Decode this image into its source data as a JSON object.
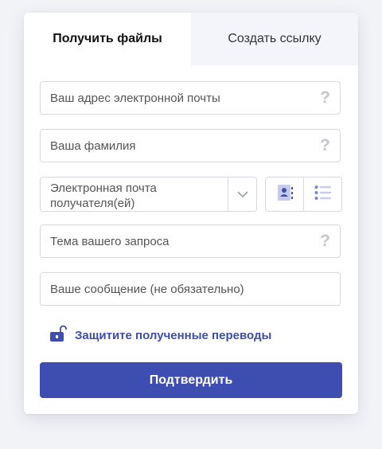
{
  "tabs": [
    {
      "label": "Получить файлы",
      "active": true
    },
    {
      "label": "Создать ссылку",
      "active": false
    }
  ],
  "form": {
    "email_placeholder": "Ваш адрес электронной почты",
    "lastname_placeholder": "Ваша фамилия",
    "recipient_placeholder": "Электронная почта получателя(ей)",
    "subject_placeholder": "Тема вашего запроса",
    "message_placeholder": "Ваше сообщение (не обязательно)",
    "help_symbol": "?"
  },
  "protect_label": "Защитите полученные переводы",
  "submit_label": "Подтвердить",
  "icons": {
    "help": "question-mark-icon",
    "dropdown": "chevron-down-icon",
    "contacts": "address-book-icon",
    "list": "list-icon",
    "lock": "unlocked-padlock-icon"
  },
  "colors": {
    "accent": "#3d4eb0",
    "link": "#3d4eaa",
    "icon_soft": "#c7cbeb",
    "icon_mid": "#7b85cf"
  }
}
